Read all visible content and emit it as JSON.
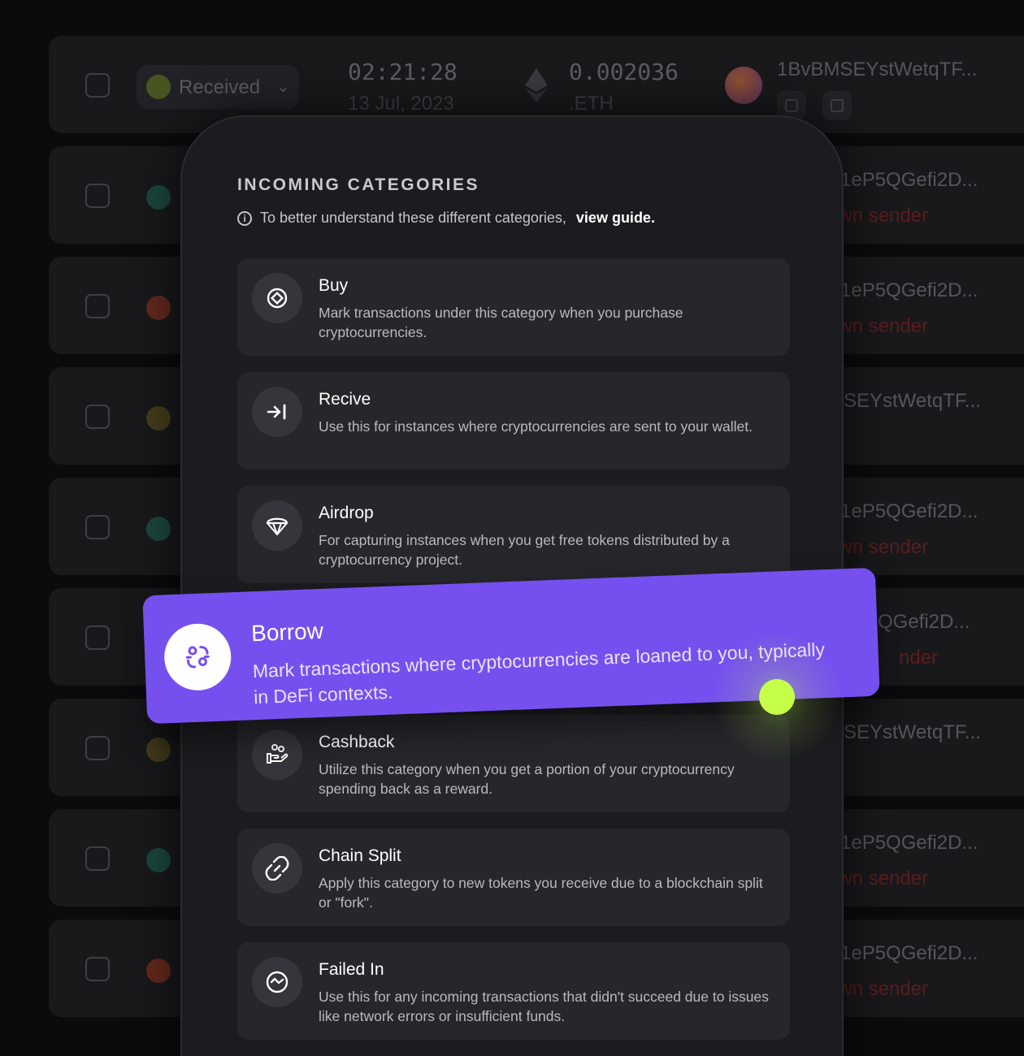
{
  "background_table": {
    "first_row": {
      "status_label": "Received",
      "time": "02:21:28",
      "date": "13 Jul, 2023",
      "amount": "0.002036",
      "unit": ".ETH",
      "address": "1BvBMSEYstWetqTF..."
    },
    "rows": [
      {
        "address": "P1eP5QGefi2D...",
        "sub": "own sender"
      },
      {
        "address": "P1eP5QGefi2D...",
        "sub": "own sender"
      },
      {
        "address": "MSEYstWetqTF...",
        "sub": ""
      },
      {
        "address": "P1eP5QGefi2D...",
        "sub": "own sender"
      },
      {
        "address": "QGefi2D...",
        "sub": "nder"
      },
      {
        "address": "MSEYstWetqTF...",
        "sub": ""
      },
      {
        "address": "P1eP5QGefi2D...",
        "sub": "own sender"
      },
      {
        "address": "P1eP5QGefi2D...",
        "sub": "own sender"
      }
    ],
    "status_colors": [
      "#1e6b5a",
      "#a0341e",
      "#6a5a1e",
      "#1e6b5a",
      "#1e6b5a",
      "#6a5a1e",
      "#1e6b5a",
      "#a0341e"
    ]
  },
  "panel": {
    "title": "INCOMING CATEGORIES",
    "subtitle": "To better understand these different categories,",
    "guide_link": "view guide.",
    "categories": [
      {
        "icon": "buy-icon",
        "name": "Buy",
        "desc": "Mark transactions under this category when you purchase cryptocurrencies."
      },
      {
        "icon": "receive-icon",
        "name": "Recive",
        "desc": "Use this for instances where cryptocurrencies are sent to your wallet."
      },
      {
        "icon": "airdrop-icon",
        "name": "Airdrop",
        "desc": "For capturing instances when you get free tokens distributed by a cryptocurrency project."
      },
      {
        "icon": "cashback-icon",
        "name": "Cashback",
        "desc": "Utilize this category when you get a portion of your cryptocurrency spending back as a reward."
      },
      {
        "icon": "chain-split-icon",
        "name": "Chain Split",
        "desc": "Apply this category to new tokens you receive due to a blockchain split or \"fork\"."
      },
      {
        "icon": "failed-in-icon",
        "name": "Failed In",
        "desc": "Use this for any incoming transactions that didn't succeed due to issues like network errors or insufficient funds."
      }
    ]
  },
  "highlight": {
    "icon": "borrow-icon",
    "name": "Borrow",
    "desc": "Mark transactions where cryptocurrencies are loaned to you, typically in DeFi contexts.",
    "color": "#7650ee"
  },
  "cursor_color": "#c6ff4a"
}
